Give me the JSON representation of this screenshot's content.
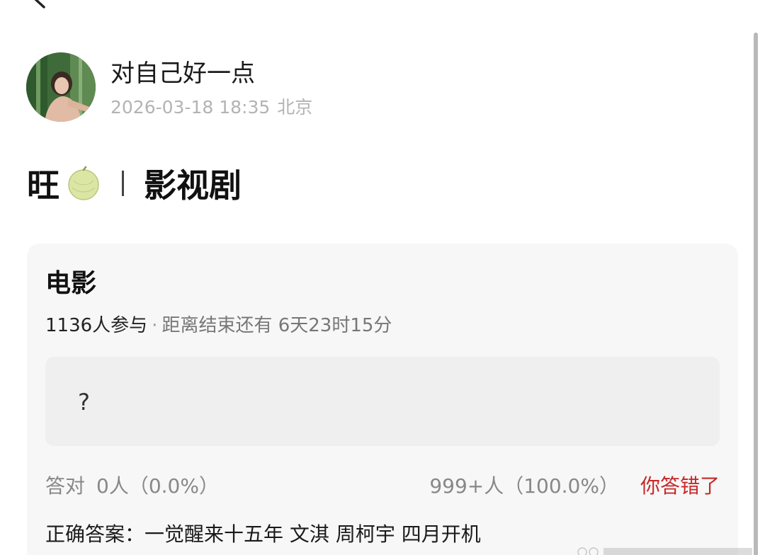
{
  "post": {
    "username": "对自己好一点",
    "date": "2026-03-18 18:35",
    "location": "北京",
    "title_prefix": "旺",
    "title_separator": "丨",
    "title_category": "影视剧"
  },
  "icons": {
    "back": "chevron-left-icon",
    "title_emoji": "melon-icon",
    "avatar": "avatar"
  },
  "quiz": {
    "title": "电影",
    "participants": "1136人参与",
    "separator": "·",
    "countdown": "距离结束还有 6天23时15分",
    "answer_placeholder": "?",
    "correct_label": "答对",
    "correct_count": "0人（0.0%）",
    "wrong_count": "999+人（100.0%）",
    "user_result": "你答错了",
    "answer_label": "正确答案：",
    "answer_value": "一觉醒来十五年 文淇 周柯宇 四月开机"
  },
  "colors": {
    "wrong_result": "#c62828",
    "meta_text": "#b3b3b3",
    "card_background": "#f7f7f7"
  }
}
